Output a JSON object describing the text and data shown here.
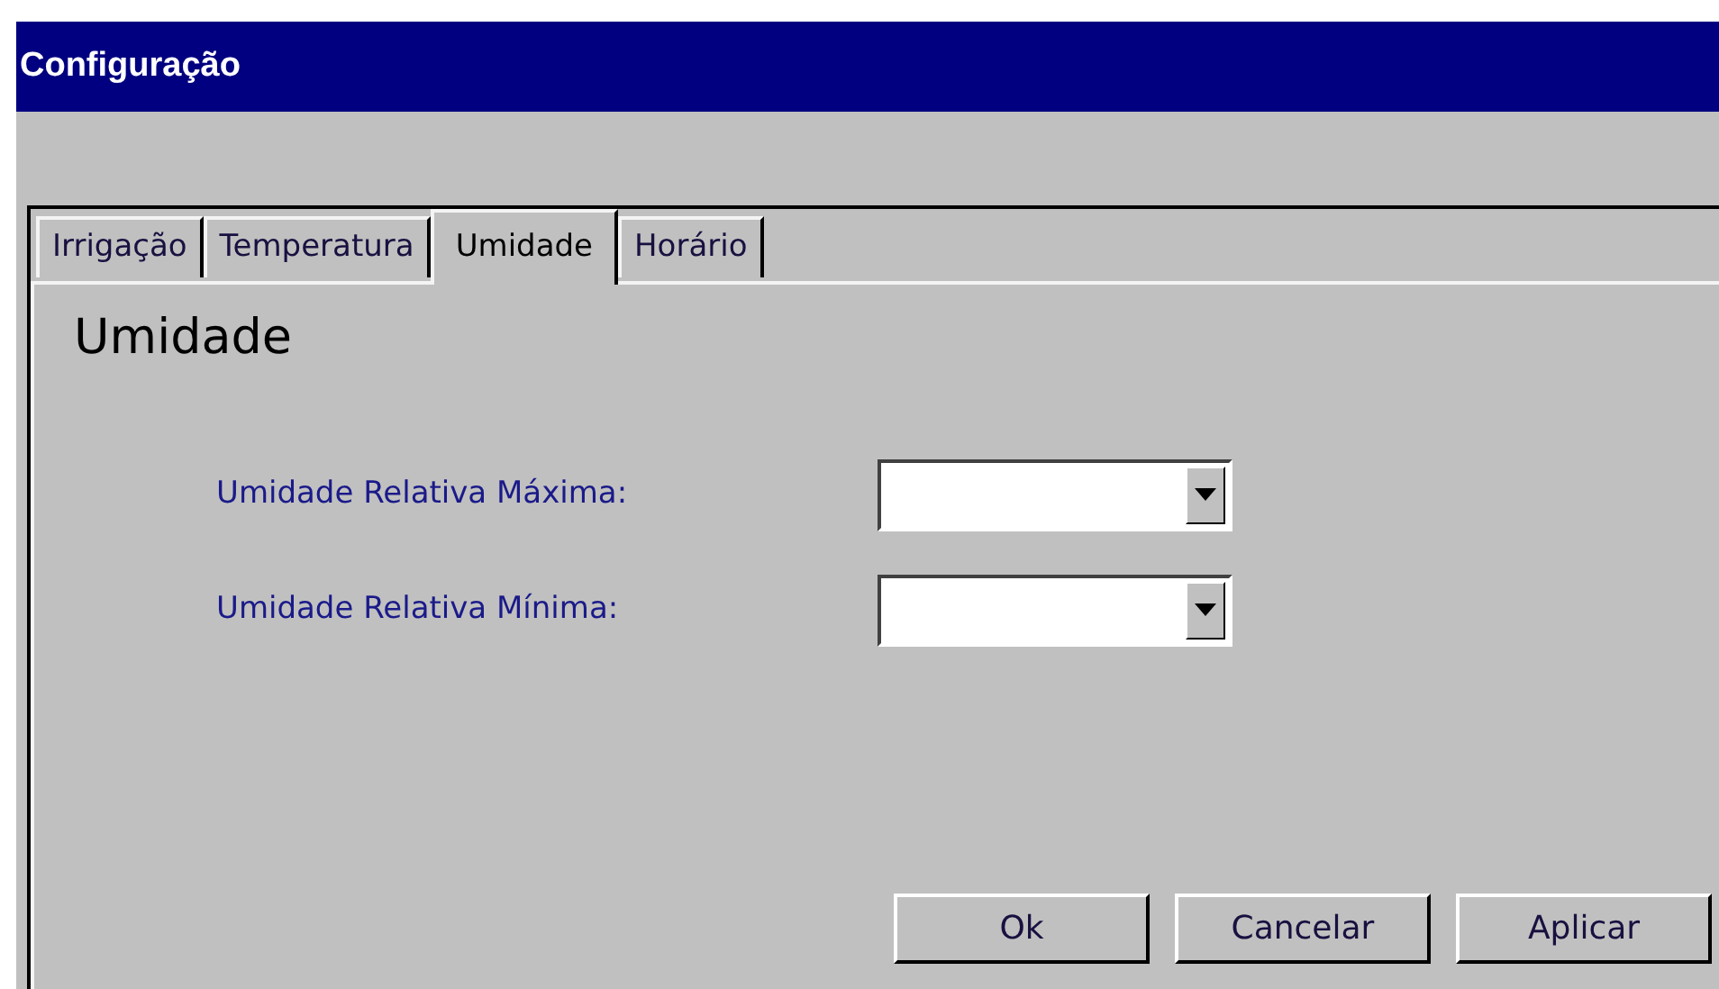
{
  "window": {
    "title": "Configuração"
  },
  "tabs": [
    {
      "label": "Irrigação",
      "selected": false
    },
    {
      "label": "Temperatura",
      "selected": false
    },
    {
      "label": "Umidade",
      "selected": true
    },
    {
      "label": "Horário",
      "selected": false
    }
  ],
  "section_title": "Umidade",
  "fields": [
    {
      "label": "Umidade Relativa Máxima:"
    },
    {
      "label": "Umidade Relativa Mínima:"
    }
  ],
  "buttons": [
    "Ok",
    "Cancelar",
    "Aplicar"
  ]
}
